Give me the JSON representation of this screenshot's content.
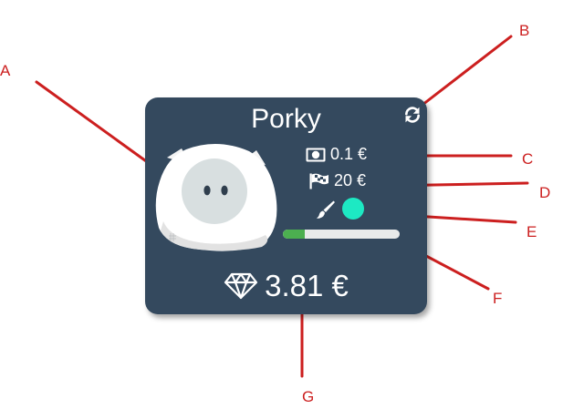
{
  "card": {
    "name": "Porky",
    "coin_value": "0.1 €",
    "goal_value": "20 €",
    "color_swatch": "#1de9c3",
    "progress_fraction": 0.19,
    "balance": "3.81 €",
    "icons": {
      "refresh": "refresh-icon",
      "coin": "banknote-icon",
      "goal": "finish-flag-icon",
      "brush": "paintbrush-icon",
      "balance": "diamond-icon",
      "avatar": "piggy-bank-avatar"
    }
  },
  "callouts": {
    "a": "A",
    "b": "B",
    "c": "C",
    "d": "D",
    "e": "E",
    "f": "F",
    "g": "G"
  },
  "colors": {
    "card_bg": "#34495e",
    "progress_fill": "#4caf50",
    "progress_track": "#e8eaea",
    "annotation": "#cc1f1f"
  }
}
